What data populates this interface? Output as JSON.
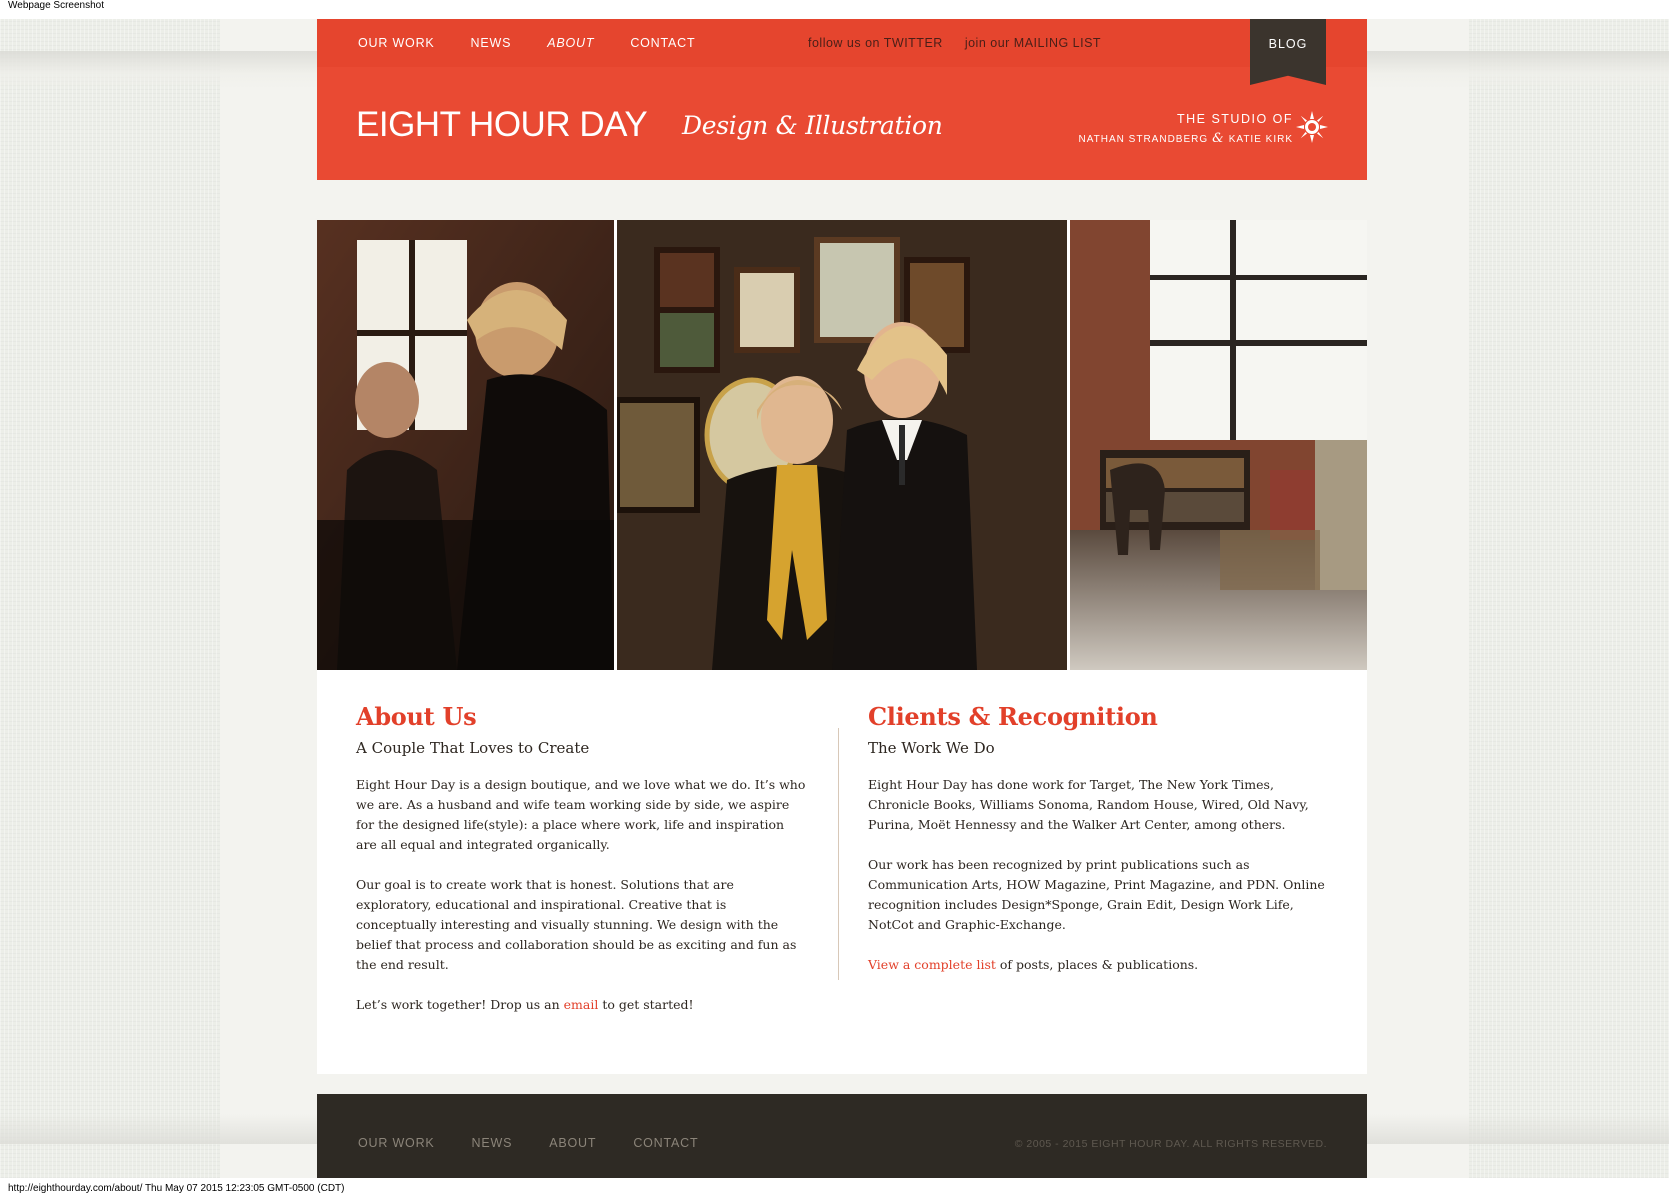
{
  "screenshot": {
    "caption": "Webpage Screenshot",
    "footer_caption": "http://eighthourday.com/about/ Thu May 07 2015 12:23:05 GMT-0500 (CDT)"
  },
  "nav": {
    "main": [
      "OUR WORK",
      "NEWS",
      "ABOUT",
      "CONTACT"
    ],
    "active": "ABOUT",
    "social": {
      "twitter_prefix": "follow us on ",
      "twitter_label": "TWITTER",
      "mailing_prefix": "join our ",
      "mailing_label": "MAILING LIST"
    },
    "blog": "BLOG"
  },
  "header": {
    "logo": "EIGHT HOUR DAY",
    "tagline": "Design & Illustration",
    "studio_line1": "THE STUDIO OF",
    "studio_name1": "NATHAN STRANDBERG",
    "studio_amp": "&",
    "studio_name2": "KATIE KIRK"
  },
  "about": {
    "title": "About Us",
    "subtitle": "A Couple That Loves to Create",
    "p1": "Eight Hour Day is a design boutique, and we love what we do. It’s who we are. As a husband and wife team working side by side, we aspire for the designed life(style): a place where work, life and inspiration are all equal and integrated organically.",
    "p2": "Our goal is to create work that is honest. Solutions that are exploratory, educational and inspirational. Creative that is conceptually interesting and visually stunning. We design with the belief that process and collaboration should be as exciting and fun as the end result.",
    "p3_before": "Let’s work together! Drop us an ",
    "p3_link": "email",
    "p3_after": " to get started!"
  },
  "clients": {
    "title": "Clients & Recognition",
    "subtitle": "The Work We Do",
    "p1": "Eight Hour Day has done work for Target, The New York Times, Chronicle Books, Williams Sonoma, Random House, Wired, Old Navy, Purina, Moët Hennessy and the Walker Art Center, among others.",
    "p2": "Our work has been recognized by print publications such as Communication Arts, HOW Magazine, Print Magazine, and PDN. Online recognition includes Design*Sponge, Grain Edit, Design Work Life, NotCot and Graphic-Exchange.",
    "p3_link": "View a complete list",
    "p3_after": " of posts, places & publications."
  },
  "footer": {
    "nav": [
      "OUR WORK",
      "NEWS",
      "ABOUT",
      "CONTACT"
    ],
    "copyright": "© 2005 - 2015 EIGHT HOUR DAY. ALL RIGHTS RESERVED."
  },
  "colors": {
    "brand_red": "#e94a33",
    "link_red": "#e2402a",
    "dark": "#2e2a24",
    "blog_tab": "#3b342d"
  }
}
